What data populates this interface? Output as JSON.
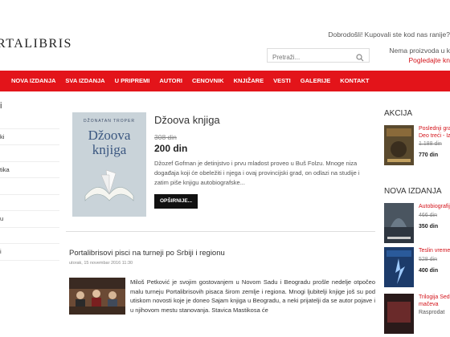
{
  "header": {
    "logo": "RTALIBRIS",
    "welcome": "Dobrodošli! Kupovali ste kod nas ranije?",
    "search_placeholder": "Pretraži...",
    "no_products_line1": "Nema proizvoda u k",
    "no_products_line2": "Pogledajte kn"
  },
  "nav": {
    "items": [
      "NOVA IZDANJA",
      "SVA IZDANJA",
      "U PRIPREMI",
      "AUTORI",
      "CENOVNIK",
      "KNJIŽARE",
      "VESTI",
      "GALERIJE",
      "KONTAKT"
    ]
  },
  "sidebar": {
    "heading": "i",
    "items": [
      "",
      "ki",
      "",
      "tika",
      "",
      "",
      "u",
      "",
      "i"
    ]
  },
  "featured": {
    "cover_author": "DŽONATAN TROPER",
    "cover_title": "Džoova knjiga",
    "title": "Džoova knjiga",
    "old_price": "308 din",
    "price": "200 din",
    "description": "Džozef Gofman je detinjstvo i prvu mladost proveo u Buš Folzu. Mnoge niza događaja koji će obeležiti i njega i ovaj provincijski grad, on odlazi na studije i zatim piše knjigu autobiografske...",
    "button": "OPŠIRNIJE..."
  },
  "news": {
    "title": "Portalibrisovi pisci na turneji po Srbiji i regionu",
    "date": "utorak, 15 novembar 2016 11:30",
    "text": "Miloš Petković je svojim gostovanjem u Novom Sadu i Beogradu prošle nedelje otpočeo malu turneju Portalibrisovih pisaca širom zemlje i regiona. Mnogi ljubitelji knjige još su pod utiskom novosti koje je doneo Sajam knjiga u Beogradu, a neki prijatelji da se autor pojave i u njihovom mestu stanovanja. Stavica Mastikosa će"
  },
  "akcija": {
    "heading": "AKCIJA",
    "items": [
      {
        "name_line1": "Poslednji gra",
        "name_line2": "Deo treći - Iz",
        "old_price": "1.188 din",
        "price": "770 din"
      }
    ]
  },
  "nova_izdanja": {
    "heading": "NOVA IZDANJA",
    "items": [
      {
        "name_line1": "Autobiografij",
        "name_line2": "",
        "old_price": "466 din",
        "price": "350 din"
      },
      {
        "name_line1": "Teslin vreme",
        "name_line2": "",
        "old_price": "528 din",
        "price": "400 din"
      },
      {
        "name_line1": "Trilogija Sed",
        "name_line2": "mačeva",
        "old_price": "",
        "price": "Rasprodat"
      }
    ]
  },
  "colors": {
    "accent": "#e3141a",
    "link": "#d4141b"
  }
}
